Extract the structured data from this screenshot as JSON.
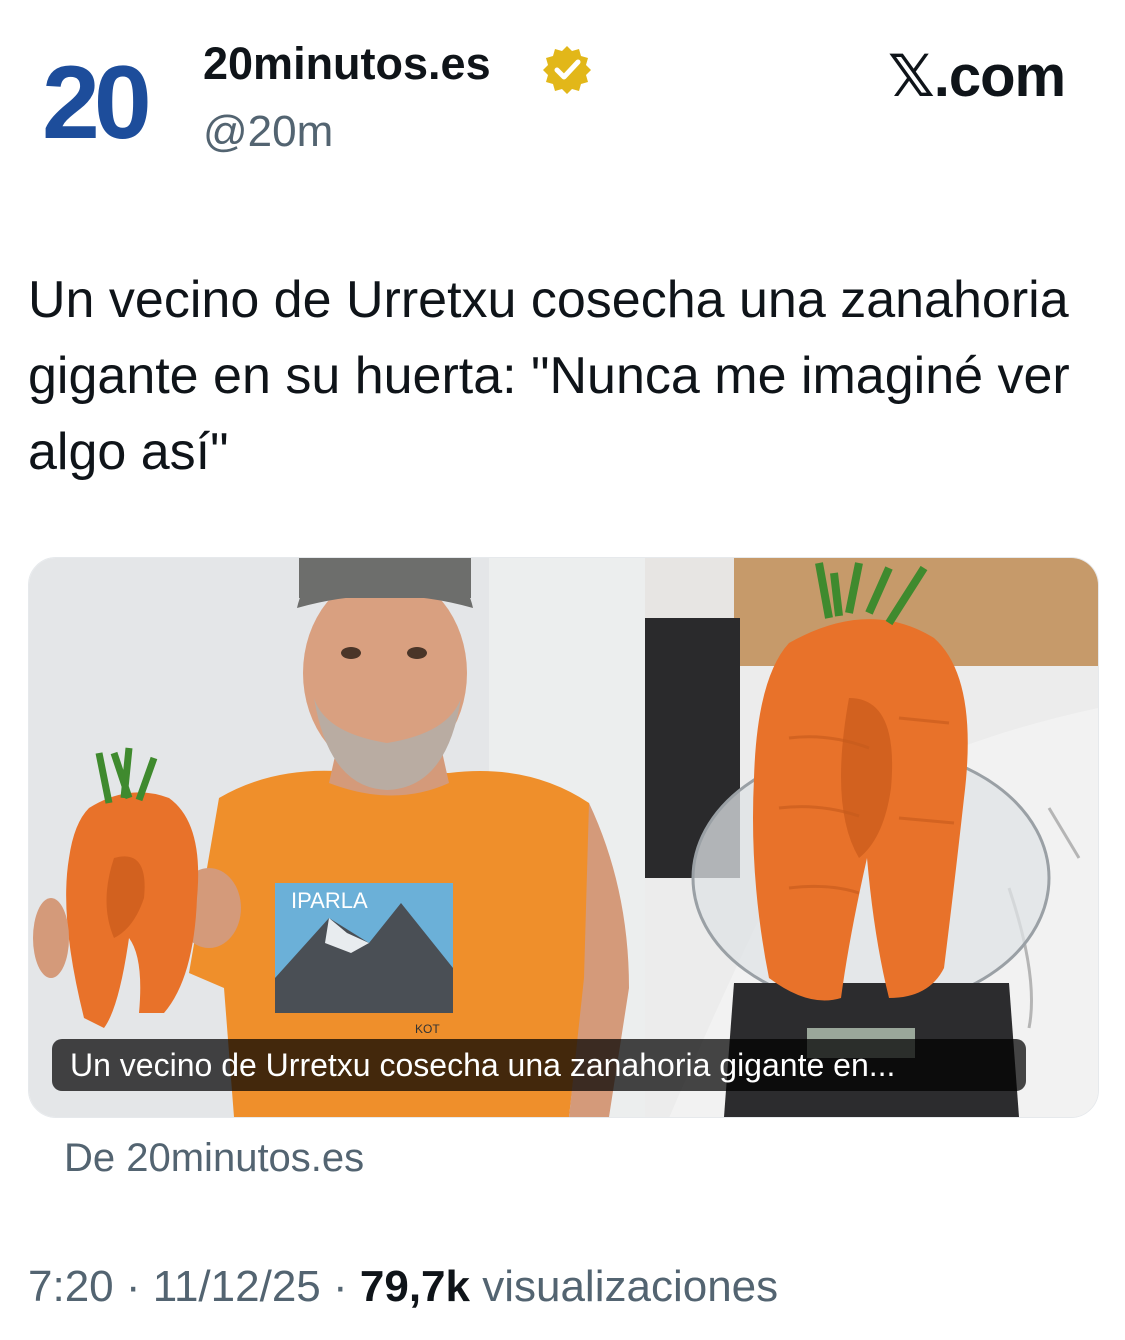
{
  "account": {
    "logo_text": "20",
    "display_name": "20minutos.es",
    "handle": "@20m",
    "verified": true,
    "verified_icon": "verified-gold-badge-icon"
  },
  "brand": {
    "site": "X.com",
    "x_glyph": "𝕏",
    "site_suffix": ".com"
  },
  "tweet": {
    "text": "Un vecino de Urretxu cosecha una zanahoria gigante en su huerta: \"Nunca me imaginé ver algo así\""
  },
  "media": {
    "caption": "Un vecino de Urretxu cosecha una zanahoria gigante en...",
    "source": "De 20minutos.es",
    "shirt_text": "IPARLA",
    "shirt_small_text": "KOT"
  },
  "meta": {
    "time": "7:20",
    "separator": " · ",
    "date": "11/12/25",
    "views_count": "79,7k",
    "views_label": "visualizaciones"
  },
  "colors": {
    "logo_blue": "#1d4d9b",
    "verified_gold": "#e2b719",
    "text_primary": "#0f1419",
    "text_secondary": "#536471",
    "carrot_orange": "#e8722a",
    "shirt_orange": "#ef8f2b"
  }
}
